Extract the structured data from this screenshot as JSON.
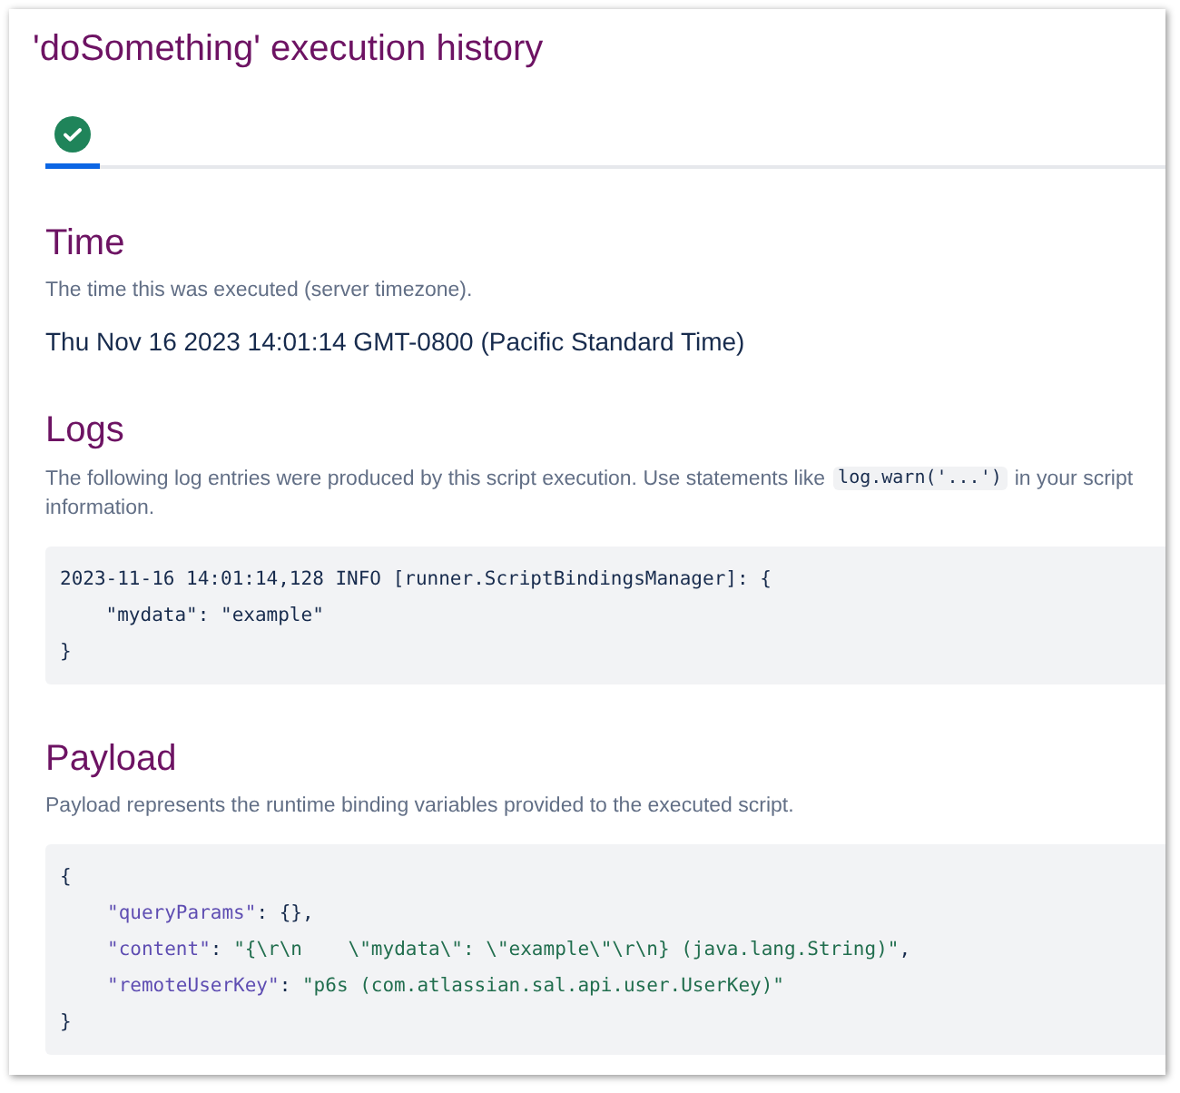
{
  "title": "'doSomething' execution history",
  "tabs": [
    {
      "kind": "success",
      "selected": true
    }
  ],
  "time": {
    "heading": "Time",
    "description": "The time this was executed (server timezone).",
    "value": "Thu Nov 16 2023 14:01:14 GMT-0800 (Pacific Standard Time)"
  },
  "logs": {
    "heading": "Logs",
    "description_before": "The following log entries were produced by this script execution. Use statements like",
    "description_code": "log.warn('...')",
    "description_after": "in your script",
    "description_continued": "information.",
    "lines": [
      "2023-11-16 14:01:14,128 INFO [runner.ScriptBindingsManager]: {",
      "    \"mydata\": \"example\"",
      "}"
    ]
  },
  "payload": {
    "heading": "Payload",
    "description": "Payload represents the runtime binding variables provided to the executed script.",
    "open": "{",
    "close": "}",
    "entries": [
      {
        "key": "\"queryParams\"",
        "sep": ": ",
        "value": "{}",
        "kind": "literal",
        "comma": ","
      },
      {
        "key": "\"content\"",
        "sep": ": ",
        "value": "\"{\\r\\n    \\\"mydata\\\": \\\"example\\\"\\r\\n} (java.lang.String)\"",
        "kind": "string",
        "comma": ","
      },
      {
        "key": "\"remoteUserKey\"",
        "sep": ": ",
        "value": "\"p6s (com.atlassian.sal.api.user.UserKey)\"",
        "kind": "string"
      }
    ]
  }
}
